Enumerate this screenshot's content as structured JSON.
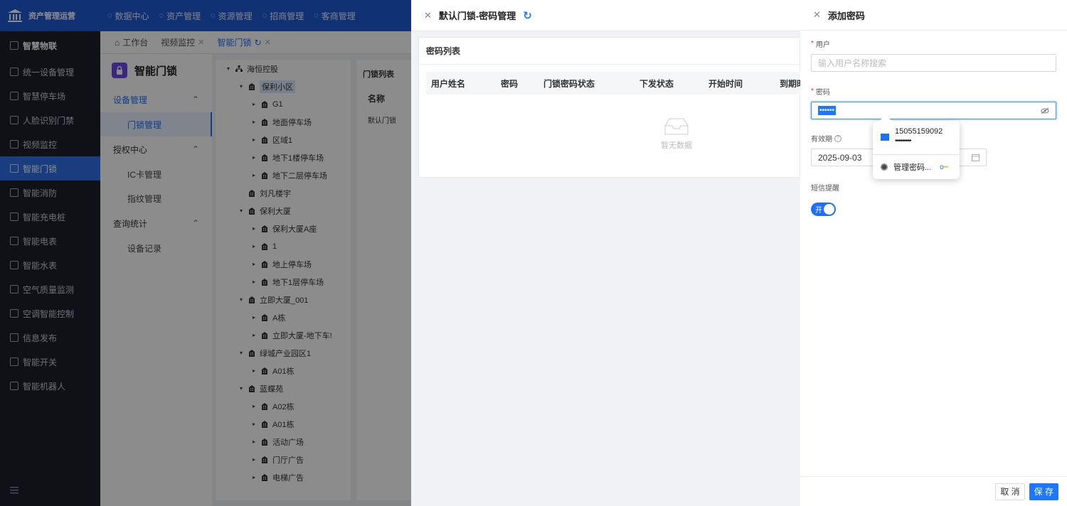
{
  "app": {
    "title": "资产管理运营"
  },
  "topnav": [
    {
      "label": "数据中心",
      "icon": "gauge-icon"
    },
    {
      "label": "资产管理",
      "icon": "box-icon"
    },
    {
      "label": "资源管理",
      "icon": "doc-icon"
    },
    {
      "label": "招商管理",
      "icon": "tag-icon"
    },
    {
      "label": "客商管理",
      "icon": "people-icon"
    }
  ],
  "sidebar": {
    "items": [
      {
        "label": "智慧物联",
        "icon": "sun-icon"
      },
      {
        "label": "统一设备管理",
        "icon": "grid-icon"
      },
      {
        "label": "智慧停车场",
        "icon": "parking-icon"
      },
      {
        "label": "人脸识别门禁",
        "icon": "face-icon"
      },
      {
        "label": "视频监控",
        "icon": "camera-icon"
      },
      {
        "label": "智能门锁",
        "icon": "lock-icon"
      },
      {
        "label": "智能消防",
        "icon": "fire-icon"
      },
      {
        "label": "智能充电桩",
        "icon": "charger-icon"
      },
      {
        "label": "智能电表",
        "icon": "meter-icon"
      },
      {
        "label": "智能水表",
        "icon": "water-icon"
      },
      {
        "label": "空气质量监测",
        "icon": "air-icon"
      },
      {
        "label": "空调智能控制",
        "icon": "ac-icon"
      },
      {
        "label": "信息发布",
        "icon": "send-icon"
      },
      {
        "label": "智能开关",
        "icon": "switch-icon"
      },
      {
        "label": "智能机器人",
        "icon": "robot-icon"
      }
    ],
    "active": "智能门锁",
    "bottom_icon": "collapse-menu-icon"
  },
  "tabs": [
    {
      "label": "工作台"
    },
    {
      "label": "视频监控"
    },
    {
      "label": "智能门锁"
    }
  ],
  "subnav": {
    "title": "智能门锁",
    "groups": [
      {
        "label": "设备管理",
        "items": [
          "门锁管理"
        ]
      },
      {
        "label": "授权中心",
        "items": [
          "IC卡管理",
          "指纹管理"
        ]
      },
      {
        "label": "查询统计",
        "items": [
          "设备记录"
        ]
      }
    ]
  },
  "tree": [
    {
      "label": "海恒控股",
      "lvl": 0,
      "car": "▾",
      "icon": "org"
    },
    {
      "label": "保利小区",
      "lvl": 1,
      "car": "▾",
      "icon": "bld",
      "sel": true
    },
    {
      "label": "G1",
      "lvl": 2,
      "car": "▸",
      "icon": "bld"
    },
    {
      "label": "地面停车场",
      "lvl": 2,
      "car": "▸",
      "icon": "bld"
    },
    {
      "label": "区域1",
      "lvl": 2,
      "car": "▸",
      "icon": "bld"
    },
    {
      "label": "地下1楼停车场",
      "lvl": 2,
      "car": "▸",
      "icon": "bld"
    },
    {
      "label": "地下二层停车场",
      "lvl": 2,
      "car": "▸",
      "icon": "bld"
    },
    {
      "label": "刘凡楼宇",
      "lvl": 1,
      "car": "",
      "icon": "bld"
    },
    {
      "label": "保利大厦",
      "lvl": 1,
      "car": "▾",
      "icon": "bld"
    },
    {
      "label": "保利大厦A座",
      "lvl": 2,
      "car": "▸",
      "icon": "bld"
    },
    {
      "label": "1",
      "lvl": 2,
      "car": "▸",
      "icon": "bld"
    },
    {
      "label": "地上停车场",
      "lvl": 2,
      "car": "▸",
      "icon": "bld"
    },
    {
      "label": "地下1层停车场",
      "lvl": 2,
      "car": "▸",
      "icon": "bld"
    },
    {
      "label": "立即大厦_001",
      "lvl": 1,
      "car": "▾",
      "icon": "bld"
    },
    {
      "label": "A栋",
      "lvl": 2,
      "car": "▸",
      "icon": "bld"
    },
    {
      "label": "立即大厦-地下车!",
      "lvl": 2,
      "car": "▸",
      "icon": "bld"
    },
    {
      "label": "绿城产业园区1",
      "lvl": 1,
      "car": "▾",
      "icon": "bld"
    },
    {
      "label": "A01栋",
      "lvl": 2,
      "car": "▸",
      "icon": "bld"
    },
    {
      "label": "蓝蝶苑",
      "lvl": 1,
      "car": "▾",
      "icon": "bld"
    },
    {
      "label": "A02栋",
      "lvl": 2,
      "car": "▸",
      "icon": "bld"
    },
    {
      "label": "A01栋",
      "lvl": 2,
      "car": "▸",
      "icon": "bld"
    },
    {
      "label": "活动广场",
      "lvl": 2,
      "car": "▸",
      "icon": "bld"
    },
    {
      "label": "门厅广告",
      "lvl": 2,
      "car": "▸",
      "icon": "bld"
    },
    {
      "label": "电梯广告",
      "lvl": 2,
      "car": "▸",
      "icon": "bld"
    }
  ],
  "doorlist": {
    "title": "门锁列表",
    "col": "名称",
    "row": "默认门锁"
  },
  "mid": {
    "title": "默认门锁-密码管理",
    "card_title": "密码列表",
    "columns": [
      "用户姓名",
      "密码",
      "门锁密码状态",
      "下发状态",
      "开始时间",
      "到期时"
    ],
    "empty": "暂无数据"
  },
  "drawer": {
    "title": "添加密码",
    "user": {
      "label": "用户",
      "placeholder": "输入用户名称搜索"
    },
    "password": {
      "label": "密码",
      "value": "••••••"
    },
    "validity": {
      "label": "有效期",
      "value": "2025-09-03"
    },
    "sms": {
      "label": "短信提醒",
      "toggle": "开"
    },
    "cancel": "取 消",
    "save": "保 存"
  },
  "autofill": {
    "username": "15055159092",
    "masked": "•••••••••",
    "manage": "管理密码..."
  }
}
